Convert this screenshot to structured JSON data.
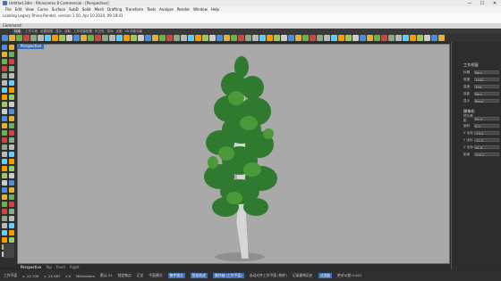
{
  "title": "Untitled.3dm - Rhinoceros 8 Commercial - [Perspective]",
  "window_controls": [
    "—",
    "☐",
    "✕"
  ],
  "menu": [
    "File",
    "Edit",
    "View",
    "Curve",
    "Surface",
    "SubD",
    "Solid",
    "Mesh",
    "Drafting",
    "Transform",
    "Tools",
    "Analyze",
    "Render",
    "Window",
    "Help"
  ],
  "history_line": "Loading Legacy Rhino Render, version 1.50, Apr 10 2024, 09:18:41",
  "command_label": "Command:",
  "tabs": [
    "标准",
    "工作平面",
    "设置视图",
    "显示",
    "选取",
    "工作视窗配置",
    "可见性",
    "变动",
    "出图",
    "V8 的新功能"
  ],
  "active_tab_index": 0,
  "viewport_label": "Perspective",
  "view_tabs": [
    "Perspective",
    "Top",
    "Front",
    "Right"
  ],
  "right_panel": {
    "title": "工作视窗",
    "rows": [
      {
        "label": "标题",
        "value": "Pers"
      },
      {
        "label": "宽度",
        "value": "1320"
      },
      {
        "label": "高度",
        "value": "756"
      },
      {
        "label": "投影",
        "value": "Pers"
      },
      {
        "label": "显示",
        "value": "Rend"
      }
    ],
    "camera_title": "摄像机",
    "camera_rows": [
      {
        "label": "镜头焦距",
        "value": "50.0"
      },
      {
        "label": "旋转",
        "value": "0.0"
      },
      {
        "label": "X 坐标",
        "value": "-74.4"
      },
      {
        "label": "Y 坐标",
        "value": "-71.5"
      },
      {
        "label": "Z 坐标",
        "value": "44.6"
      },
      {
        "label": "距离",
        "value": "105.1"
      }
    ]
  },
  "status": {
    "plane": "工作平面",
    "x": "x -12.709",
    "y": "y -25.967",
    "z": "z 0",
    "unit": "Millimeters",
    "layer": "默认 01",
    "items": [
      "锁定格点",
      "正交",
      "平面模式",
      "物件锁点",
      "智慧轨迹",
      "操作轴 (工作平面)",
      "自动对齐工作平面 (物件)",
      "记录建构历史",
      "过滤器",
      "绝对公差:0.001"
    ]
  }
}
